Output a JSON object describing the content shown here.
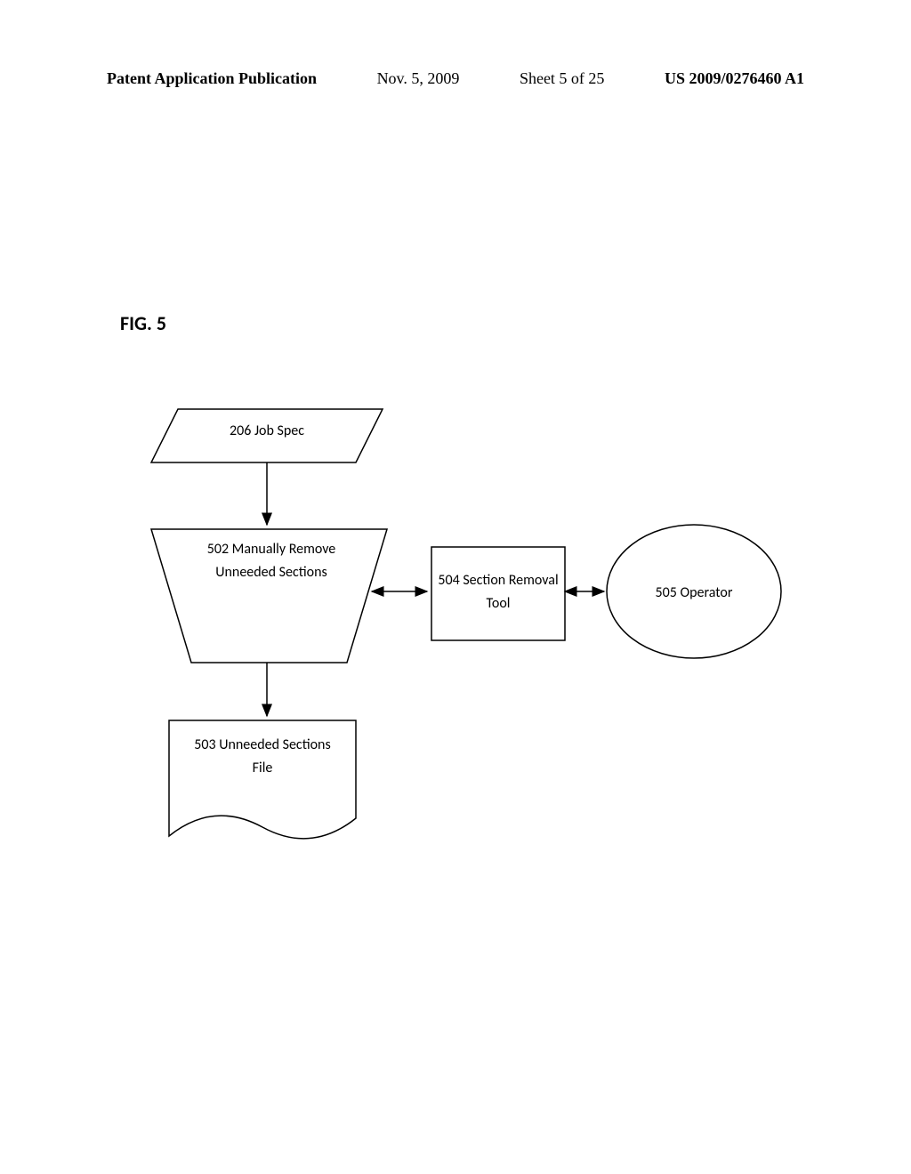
{
  "header": {
    "left": "Patent Application Publication",
    "date": "Nov. 5, 2009",
    "sheet": "Sheet 5 of 25",
    "pubnum": "US 2009/0276460 A1"
  },
  "figure_title": "FIG. 5",
  "shapes": {
    "job_spec": "206 Job Spec",
    "manual_remove": "502 Manually Remove Unneeded Sections",
    "unneeded_file": "503 Unneeded Sections File",
    "removal_tool": "504 Section Removal Tool",
    "operator": "505 Operator"
  },
  "chart_data": {
    "type": "flowchart",
    "title": "FIG. 5",
    "nodes": [
      {
        "id": "206",
        "label": "206 Job Spec",
        "shape": "parallelogram"
      },
      {
        "id": "502",
        "label": "502 Manually Remove Unneeded Sections",
        "shape": "manual-operation-trapezoid"
      },
      {
        "id": "503",
        "label": "503 Unneeded Sections File",
        "shape": "document"
      },
      {
        "id": "504",
        "label": "504 Section Removal Tool",
        "shape": "rectangle"
      },
      {
        "id": "505",
        "label": "505 Operator",
        "shape": "circle"
      }
    ],
    "edges": [
      {
        "from": "206",
        "to": "502",
        "style": "arrow"
      },
      {
        "from": "502",
        "to": "503",
        "style": "arrow"
      },
      {
        "from": "502",
        "to": "504",
        "style": "double-arrow"
      },
      {
        "from": "504",
        "to": "505",
        "style": "double-arrow"
      }
    ]
  }
}
